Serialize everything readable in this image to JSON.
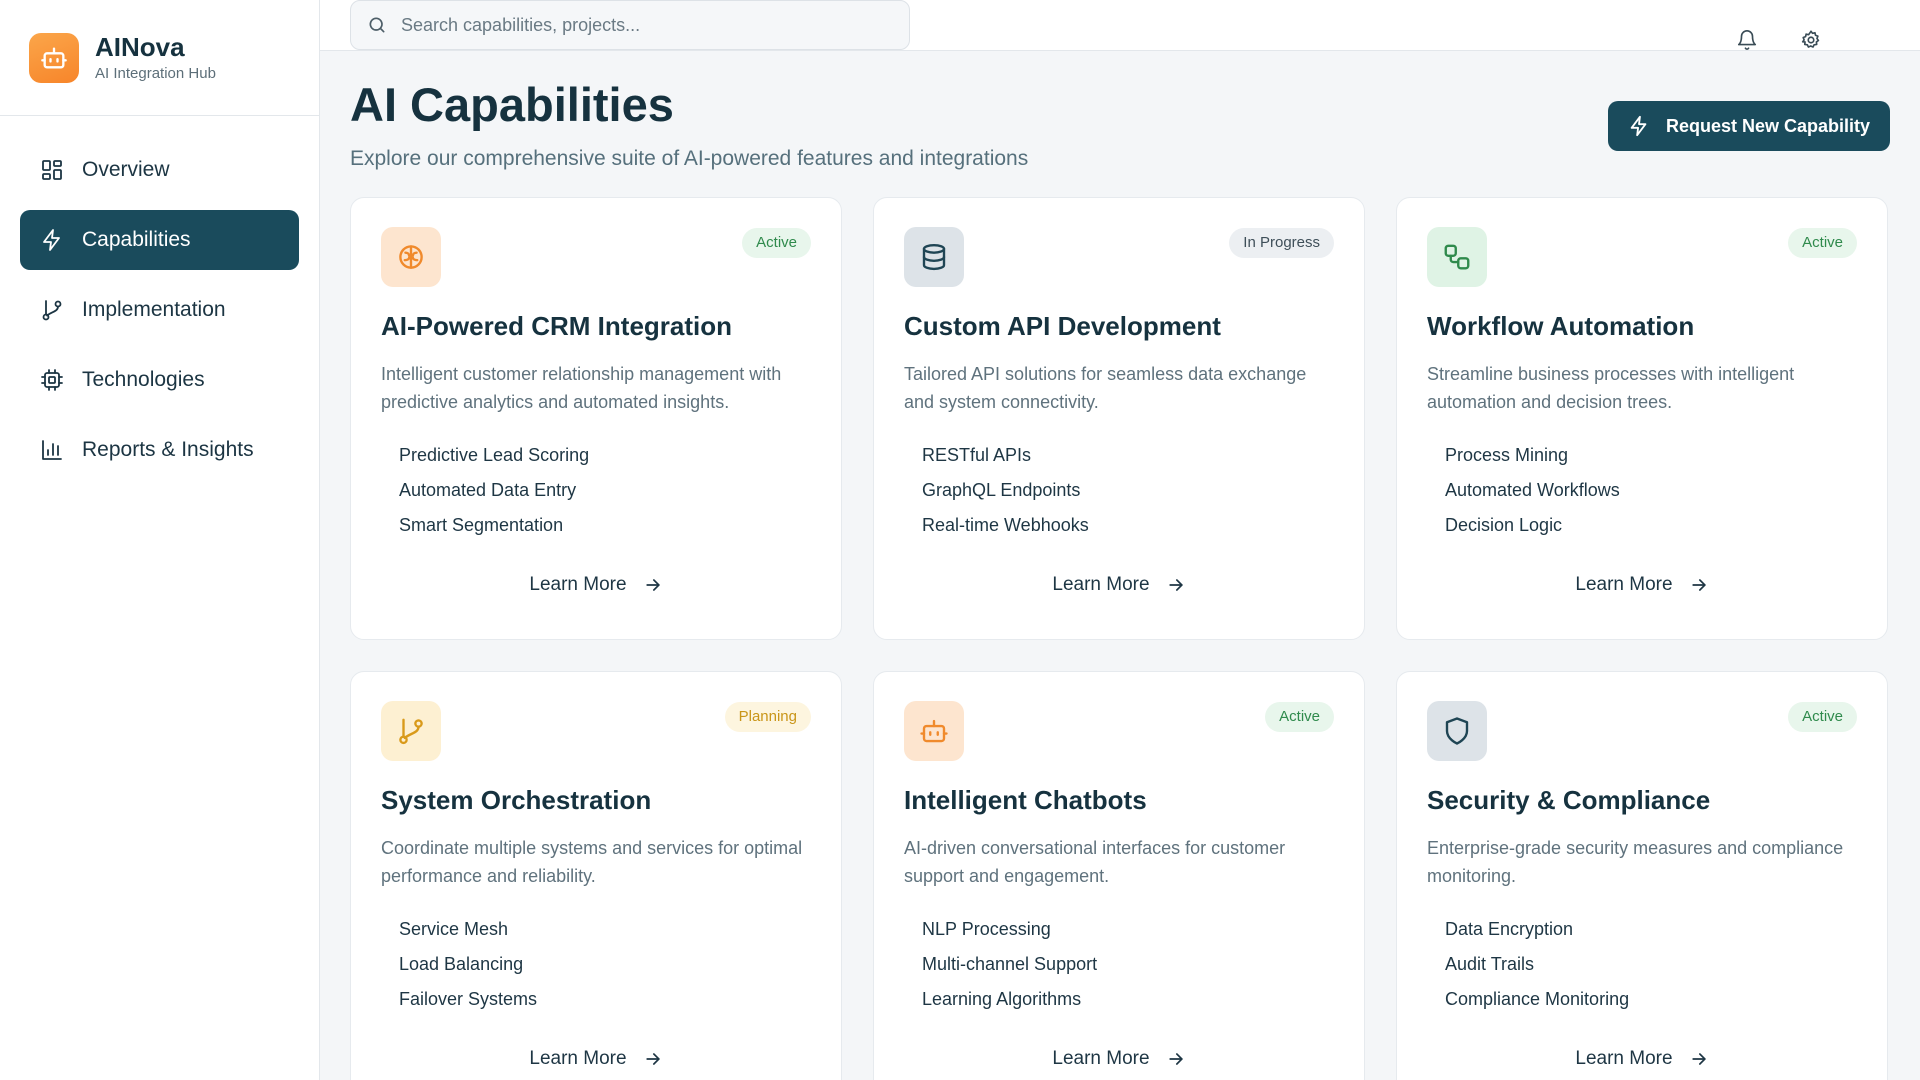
{
  "brand": {
    "name": "AINova",
    "subtitle": "AI Integration Hub"
  },
  "nav": [
    {
      "label": "Overview",
      "icon": "grid-icon",
      "active": false
    },
    {
      "label": "Capabilities",
      "icon": "bolt-icon",
      "active": true
    },
    {
      "label": "Implementation",
      "icon": "git-branch-icon",
      "active": false
    },
    {
      "label": "Technologies",
      "icon": "cpu-icon",
      "active": false
    },
    {
      "label": "Reports & Insights",
      "icon": "bar-chart-icon",
      "active": false
    }
  ],
  "search": {
    "placeholder": "Search capabilities, projects..."
  },
  "page": {
    "title": "AI Capabilities",
    "subtitle": "Explore our comprehensive suite of AI-powered features and integrations",
    "request_button": "Request New Capability"
  },
  "learn_more_label": "Learn More",
  "status_colors": {
    "Active": {
      "bg": "#e8f6ec",
      "fg": "#2f8a4c"
    },
    "In Progress": {
      "bg": "#eceff2",
      "fg": "#3f4f59"
    },
    "Planning": {
      "bg": "#fdf5df",
      "fg": "#c99518"
    }
  },
  "cards": [
    {
      "title": "AI-Powered CRM Integration",
      "description": "Intelligent customer relationship management with predictive analytics and automated insights.",
      "status": "Active",
      "icon": "brain-icon",
      "icon_bg": "#fde5cf",
      "icon_color": "#f08a2c",
      "features": [
        "Predictive Lead Scoring",
        "Automated Data Entry",
        "Smart Segmentation"
      ]
    },
    {
      "title": "Custom API Development",
      "description": "Tailored API solutions for seamless data exchange and system connectivity.",
      "status": "In Progress",
      "icon": "database-icon",
      "icon_bg": "#dde3e8",
      "icon_color": "#1f4554",
      "features": [
        "RESTful APIs",
        "GraphQL Endpoints",
        "Real-time Webhooks"
      ]
    },
    {
      "title": "Workflow Automation",
      "description": "Streamline business processes with intelligent automation and decision trees.",
      "status": "Active",
      "icon": "workflow-icon",
      "icon_bg": "#dff3e5",
      "icon_color": "#2f8a4c",
      "features": [
        "Process Mining",
        "Automated Workflows",
        "Decision Logic"
      ]
    },
    {
      "title": "System Orchestration",
      "description": "Coordinate multiple systems and services for optimal performance and reliability.",
      "status": "Planning",
      "icon": "git-branch-icon",
      "icon_bg": "#fdf0d2",
      "icon_color": "#d99a1a",
      "features": [
        "Service Mesh",
        "Load Balancing",
        "Failover Systems"
      ]
    },
    {
      "title": "Intelligent Chatbots",
      "description": "AI-driven conversational interfaces for customer support and engagement.",
      "status": "Active",
      "icon": "bot-icon",
      "icon_bg": "#fde5cf",
      "icon_color": "#f08a2c",
      "features": [
        "NLP Processing",
        "Multi-channel Support",
        "Learning Algorithms"
      ]
    },
    {
      "title": "Security & Compliance",
      "description": "Enterprise-grade security measures and compliance monitoring.",
      "status": "Active",
      "icon": "shield-icon",
      "icon_bg": "#dde3e8",
      "icon_color": "#1f4554",
      "features": [
        "Data Encryption",
        "Audit Trails",
        "Compliance Monitoring"
      ]
    }
  ]
}
